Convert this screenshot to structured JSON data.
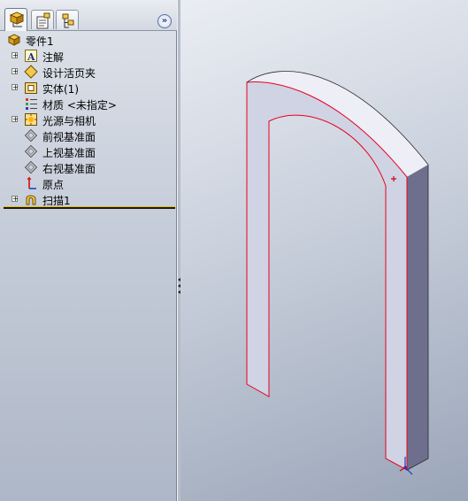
{
  "feature_manager": {
    "tabs": [
      {
        "name": "featuremanager-tab",
        "icon": "feature-tree-icon",
        "active": true
      },
      {
        "name": "propertymanager-tab",
        "icon": "property-manager-icon",
        "active": false
      },
      {
        "name": "configurationmanager-tab",
        "icon": "configuration-manager-icon",
        "active": false
      }
    ],
    "collapse_label": "»",
    "root": {
      "label": "零件1",
      "icon": "part-icon"
    },
    "items": [
      {
        "label": "注解",
        "icon": "annotations-icon",
        "expandable": true
      },
      {
        "label": "设计活页夹",
        "icon": "design-binder-icon",
        "expandable": true
      },
      {
        "label": "实体(1)",
        "icon": "solid-bodies-icon",
        "expandable": true
      },
      {
        "label": "材质 <未指定>",
        "icon": "material-icon",
        "expandable": false
      },
      {
        "label": "光源与相机",
        "icon": "lights-cameras-icon",
        "expandable": true
      },
      {
        "label": "前视基准面",
        "icon": "plane-icon",
        "expandable": false
      },
      {
        "label": "上视基准面",
        "icon": "plane-icon",
        "expandable": false
      },
      {
        "label": "右视基准面",
        "icon": "plane-icon",
        "expandable": false
      },
      {
        "label": "原点",
        "icon": "origin-icon",
        "expandable": false
      },
      {
        "label": "扫描1",
        "icon": "sweep-icon",
        "expandable": true
      }
    ]
  },
  "colors": {
    "selection_edge": "#e8001c",
    "model_front": "#cfd3e4",
    "model_side": "#6e6f8c",
    "model_top": "#eeeef7"
  }
}
